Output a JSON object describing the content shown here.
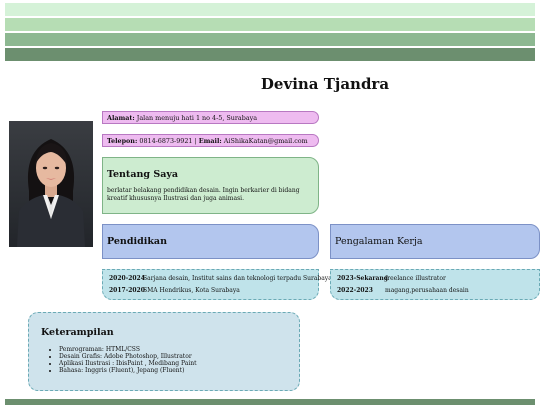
{
  "name": "Devina Tjandra",
  "contact": {
    "address_label": "Alamat:",
    "address": "Jalan menuju hati 1 no 4-5, Surabaya",
    "phone_label": "Telepon:",
    "phone": "0814-6873-9921",
    "separator": "|",
    "email_label": "Email:",
    "email": "AiShikaKatan@gmail.com"
  },
  "about": {
    "title": "Tentang Saya",
    "text": "berlatar belakang pendidikan desain. Ingin berkarier di bidang kreatif khususnya Ilustrasi dan juga animasi."
  },
  "education": {
    "title": "Pendidikan",
    "items": [
      {
        "years": "2020-2024",
        "desc": "Sarjana desain, Institut sains dan teknologi terpadu Surabaya"
      },
      {
        "years": "2017-2020",
        "desc": "SMA Hendrikus, Kota Surabaya"
      }
    ]
  },
  "experience": {
    "title": "Pengalaman Kerja",
    "items": [
      {
        "years": "2023-Sekarang",
        "desc": "freelance illustrator"
      },
      {
        "years": "2022-2023",
        "desc": "magang,perusahaan desain"
      }
    ]
  },
  "skills": {
    "title": "Keterampilan",
    "items": [
      "Pemrograman: HTML/CSS",
      "Desain Grafis: Adobe Photoshop, Illustrator",
      "Aplikasi Ilustrasi : IbisPaint , Medibang Paint",
      "Bahasa: Inggris (Fluent), Jepang (Fluent)"
    ]
  },
  "colors": {
    "band_light": "#d5f2d8",
    "band_dark": "#6c8f6f",
    "contact_pill": "#eebbf0",
    "about_box": "#cdecd0",
    "section_head": "#b3c6ee",
    "timeline_box": "#bfe3ea",
    "skills_box": "#cfe3ec"
  }
}
